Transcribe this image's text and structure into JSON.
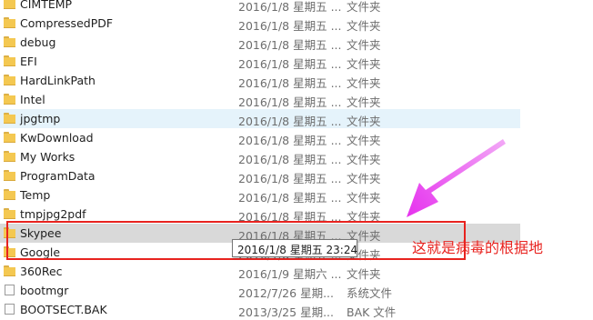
{
  "files": [
    {
      "name": "CIMTEMP",
      "date": "2016/1/8 星期五 ...",
      "type": "文件夹",
      "icon": "folder-icon",
      "state": "normal"
    },
    {
      "name": "CompressedPDF",
      "date": "2016/1/8 星期五 ...",
      "type": "文件夹",
      "icon": "folder-icon",
      "state": "normal"
    },
    {
      "name": "debug",
      "date": "2016/1/8 星期五 ...",
      "type": "文件夹",
      "icon": "folder-icon",
      "state": "normal"
    },
    {
      "name": "EFI",
      "date": "2016/1/8 星期五 ...",
      "type": "文件夹",
      "icon": "folder-icon",
      "state": "normal"
    },
    {
      "name": "HardLinkPath",
      "date": "2016/1/8 星期五 ...",
      "type": "文件夹",
      "icon": "folder-icon",
      "state": "normal"
    },
    {
      "name": "Intel",
      "date": "2016/1/8 星期五 ...",
      "type": "文件夹",
      "icon": "folder-icon",
      "state": "normal"
    },
    {
      "name": "jpgtmp",
      "date": "2016/1/8 星期五 ...",
      "type": "文件夹",
      "icon": "folder-icon",
      "state": "hover"
    },
    {
      "name": "KwDownload",
      "date": "2016/1/8 星期五 ...",
      "type": "文件夹",
      "icon": "folder-icon",
      "state": "normal"
    },
    {
      "name": "My Works",
      "date": "2016/1/8 星期五 ...",
      "type": "文件夹",
      "icon": "folder-icon",
      "state": "normal"
    },
    {
      "name": "ProgramData",
      "date": "2016/1/8 星期五 ...",
      "type": "文件夹",
      "icon": "folder-icon",
      "state": "normal"
    },
    {
      "name": "Temp",
      "date": "2016/1/8 星期五 ...",
      "type": "文件夹",
      "icon": "folder-icon",
      "state": "normal"
    },
    {
      "name": "tmpjpg2pdf",
      "date": "2016/1/8 星期五 ...",
      "type": "文件夹",
      "icon": "folder-icon",
      "state": "normal"
    },
    {
      "name": "Skypee",
      "date": "2016/1/8 星期五 ...",
      "type": "文件夹",
      "icon": "folder-icon",
      "state": "selected"
    },
    {
      "name": "Google",
      "date": "2016/1/8 星期五 ...",
      "type": "文件夹",
      "icon": "folder-icon",
      "state": "normal"
    },
    {
      "name": "360Rec",
      "date": "2016/1/9 星期六 ...",
      "type": "文件夹",
      "icon": "folder-icon",
      "state": "normal"
    },
    {
      "name": "bootmgr",
      "date": "2012/7/26 星期...",
      "type": "系统文件",
      "icon": "file-icon",
      "state": "normal"
    },
    {
      "name": "BOOTSECT.BAK",
      "date": "2013/3/25 星期...",
      "type": "BAK 文件",
      "icon": "file-icon",
      "state": "normal"
    }
  ],
  "tooltip": {
    "text": "2016/1/8 星期五 23:24"
  },
  "annotation": {
    "text": "这就是病毒的根据地",
    "color": "#e8231f",
    "arrow_color": "#e633ee"
  },
  "colors": {
    "hover_row": "#e5f3fb",
    "selected_row": "#d9d9d9",
    "folder": "#f4c851"
  }
}
